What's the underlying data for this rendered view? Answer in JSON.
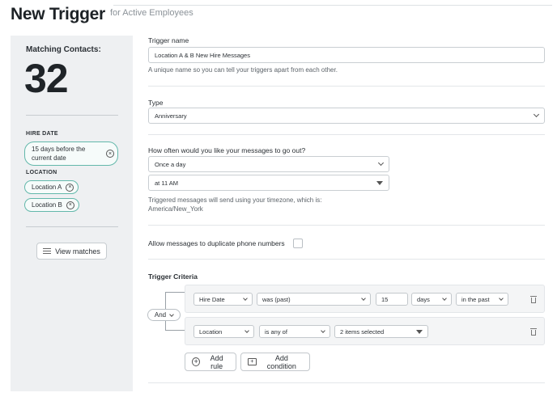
{
  "header": {
    "title": "New Trigger",
    "subtitle": "for Active Employees"
  },
  "sidebar": {
    "matching_label": "Matching Contacts:",
    "matching_count": "32",
    "hire_date_heading": "HIRE DATE",
    "hire_date_chip": "15 days before the current date",
    "location_heading": "LOCATION",
    "location_chips": [
      "Location A",
      "Location B"
    ],
    "view_matches_label": "View matches"
  },
  "form": {
    "trigger_name_label": "Trigger name",
    "trigger_name_value": "Location A & B New Hire Messages",
    "trigger_name_help": "A unique name so you can tell your triggers apart from each other.",
    "type_label": "Type",
    "type_value": "Anniversary",
    "frequency_label": "How often would you like your messages to go out?",
    "frequency_value": "Once a day",
    "time_value": "at 11 AM",
    "timezone_help": "Triggered messages will send using your timezone, which is:",
    "timezone_value": "America/New_York",
    "duplicate_label": "Allow messages to duplicate phone numbers",
    "duplicate_checked": false
  },
  "criteria": {
    "label": "Trigger Criteria",
    "join_value": "And",
    "rules": [
      {
        "field": "Hire Date",
        "operator": "was (past)",
        "amount": "15",
        "unit": "days",
        "direction": "in the past"
      },
      {
        "field": "Location",
        "operator": "is any of",
        "value": "2 items selected"
      }
    ],
    "add_rule_label": "Add rule",
    "add_condition_label": "Add condition"
  },
  "colors": {
    "chip_border": "#63b8ab",
    "sidebar_bg": "#eef0f2"
  }
}
